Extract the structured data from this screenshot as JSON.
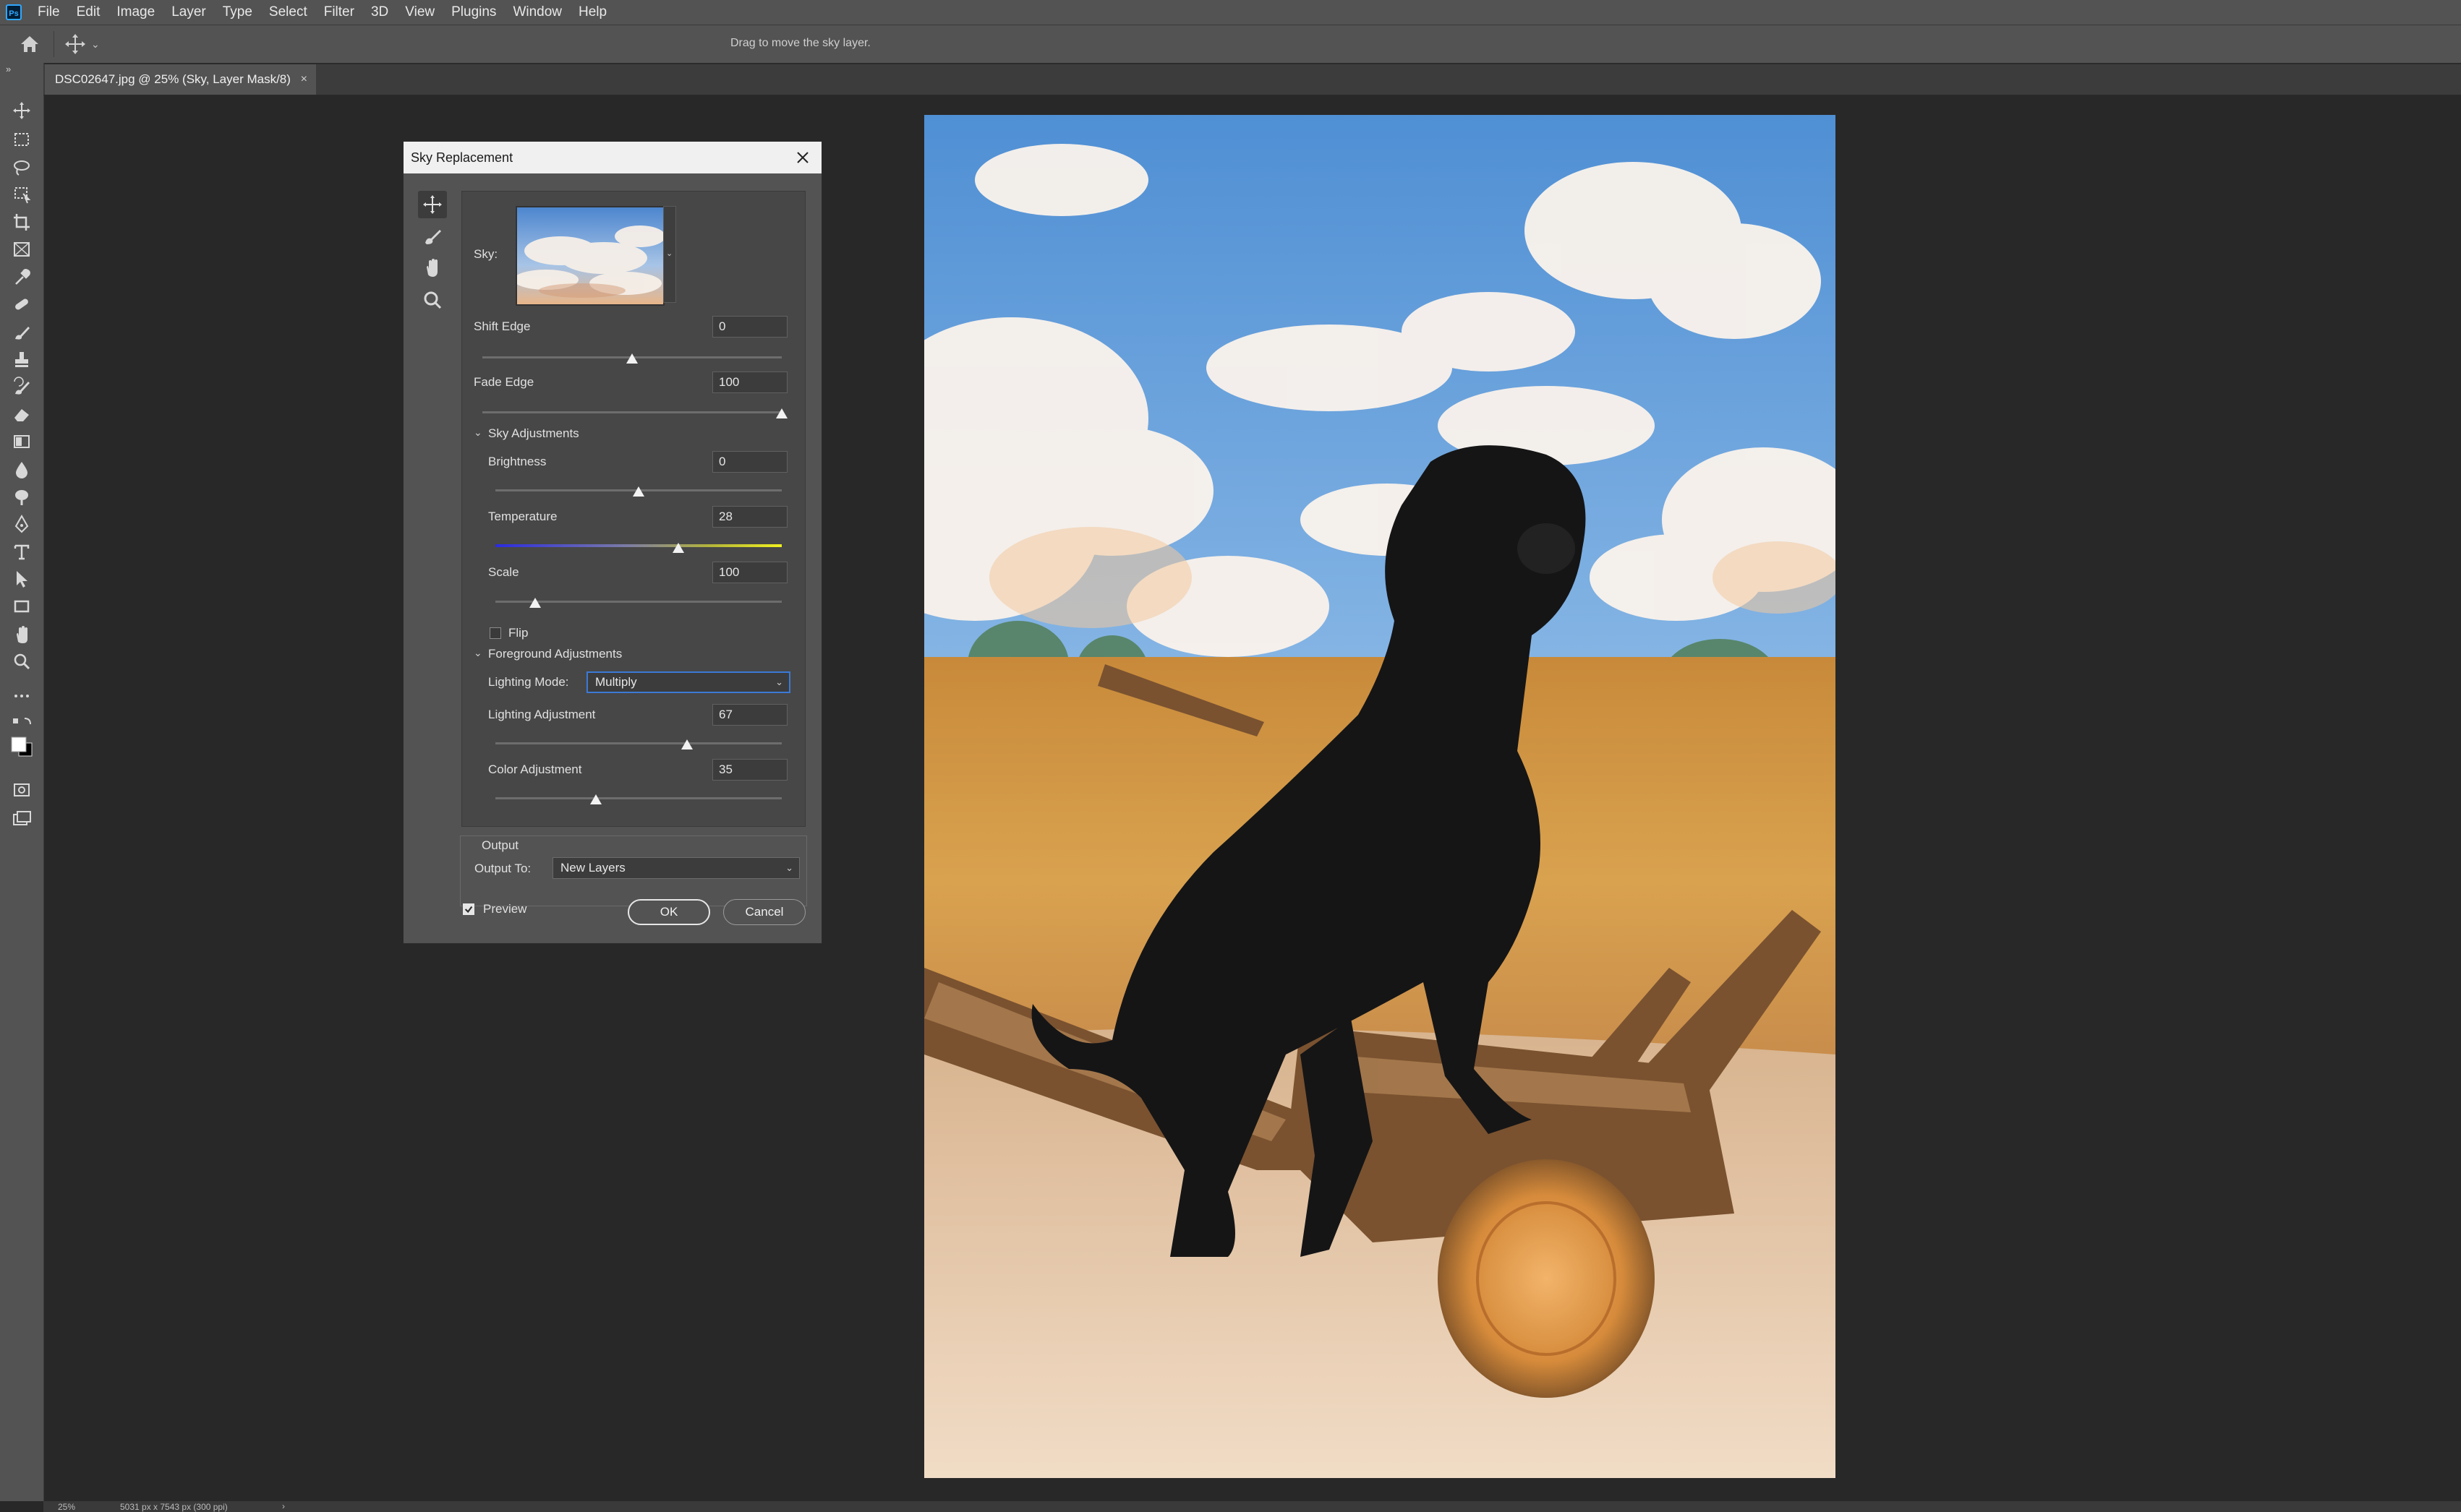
{
  "menu": [
    "File",
    "Edit",
    "Image",
    "Layer",
    "Type",
    "Select",
    "Filter",
    "3D",
    "View",
    "Plugins",
    "Window",
    "Help"
  ],
  "ps_logo": "Ps",
  "options_bar": {
    "hint": "Drag to move the sky layer."
  },
  "document_tab": {
    "label": "DSC02647.jpg @ 25% (Sky, Layer Mask/8)",
    "close": "×"
  },
  "status_bar": {
    "zoom": "25%",
    "size": "5031 px x 7543 px (300 ppi)",
    "arrow": "›"
  },
  "dialog": {
    "title": "Sky Replacement",
    "sky_label": "Sky:",
    "shift_edge": {
      "label": "Shift Edge",
      "value": "0",
      "slider": 50
    },
    "fade_edge": {
      "label": "Fade Edge",
      "value": "100",
      "slider": 100
    },
    "sky_adjustments": {
      "header": "Sky Adjustments",
      "brightness": {
        "label": "Brightness",
        "value": "0",
        "slider": 50
      },
      "temperature": {
        "label": "Temperature",
        "value": "28",
        "slider": 64
      },
      "scale": {
        "label": "Scale",
        "value": "100",
        "slider": 14
      },
      "flip": {
        "label": "Flip",
        "checked": false
      }
    },
    "foreground_adjustments": {
      "header": "Foreground Adjustments",
      "lighting_mode_label": "Lighting Mode:",
      "lighting_mode_value": "Multiply",
      "lighting_adjustment": {
        "label": "Lighting Adjustment",
        "value": "67",
        "slider": 67
      },
      "color_adjustment": {
        "label": "Color Adjustment",
        "value": "35",
        "slider": 35
      }
    },
    "output": {
      "header": "Output",
      "to_label": "Output To:",
      "to_value": "New Layers"
    },
    "preview": {
      "label": "Preview",
      "checked": true
    },
    "ok_label": "OK",
    "cancel_label": "Cancel"
  },
  "colors": {
    "accent": "#3b7ad6",
    "panel": "#535353",
    "canvas": "#282828"
  }
}
